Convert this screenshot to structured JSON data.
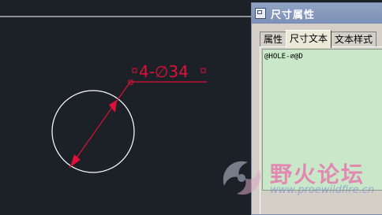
{
  "drawing": {
    "dimension_text": "4-∅34"
  },
  "dialog": {
    "title": "尺寸属性",
    "tabs": [
      {
        "label": "属性",
        "active": false
      },
      {
        "label": "尺寸文本",
        "active": true
      },
      {
        "label": "文本样式",
        "active": false
      }
    ],
    "text_value": "@HOLE-∅@D"
  },
  "watermark": {
    "title": "野火论坛",
    "url": "www.proewildfire.cn"
  },
  "colors": {
    "canvas_bg": "#1c2127",
    "dimension": "#e0103a",
    "circle": "#ffffff",
    "text_area_bg": "#c9e8c9"
  }
}
